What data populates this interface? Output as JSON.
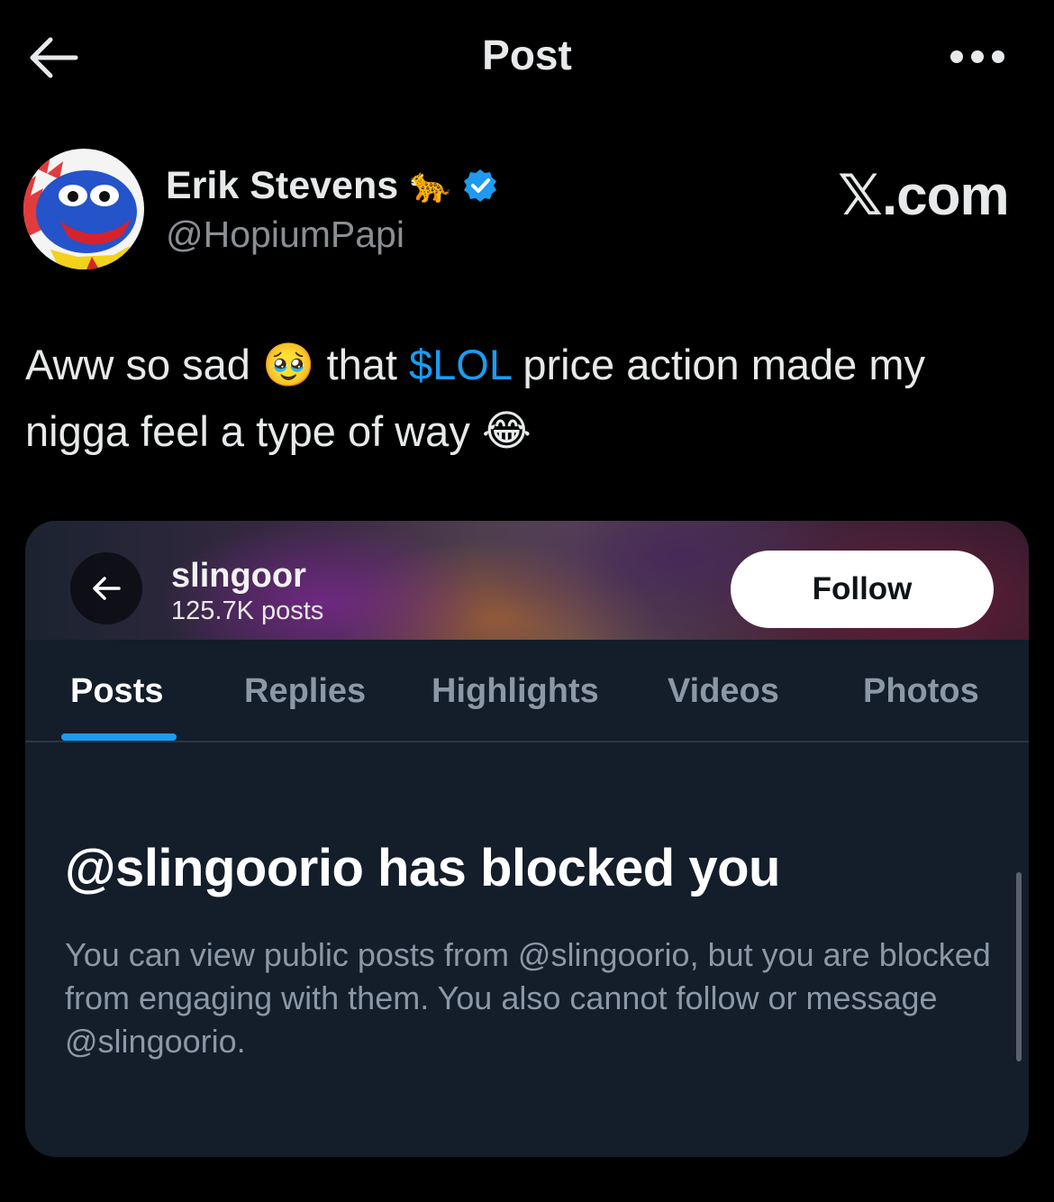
{
  "header": {
    "title": "Post",
    "back_icon": "back-arrow-icon",
    "more_icon": "more-horizontal-icon"
  },
  "author": {
    "name": "Erik Stevens",
    "badge_emoji": "🐆",
    "handle": "@HopiumPapi",
    "verified_color": "#1d9bf0"
  },
  "watermark": "𝕏.com",
  "tweet": {
    "text_1": "Aww so sad ",
    "emoji_1": "🥹",
    "text_2": " that ",
    "cashtag": "$LOL",
    "text_3": " price action made my nigga feel a type of way ",
    "emoji_2": "😂"
  },
  "embedded": {
    "profile_name": "slingoor",
    "post_count": "125.7K posts",
    "follow_label": "Follow",
    "tabs": [
      {
        "label": "Posts",
        "active": true
      },
      {
        "label": "Replies",
        "active": false
      },
      {
        "label": "Highlights",
        "active": false
      },
      {
        "label": "Videos",
        "active": false
      },
      {
        "label": "Photos",
        "active": false
      }
    ],
    "blocked_title": "@slingoorio has blocked you",
    "blocked_desc": "You can view public posts from @slingoorio, but you are blocked from engaging with them. You also cannot follow or message @slingoorio."
  },
  "colors": {
    "accent": "#1d9bf0",
    "background": "#000000",
    "card_bg": "#141d2a"
  }
}
